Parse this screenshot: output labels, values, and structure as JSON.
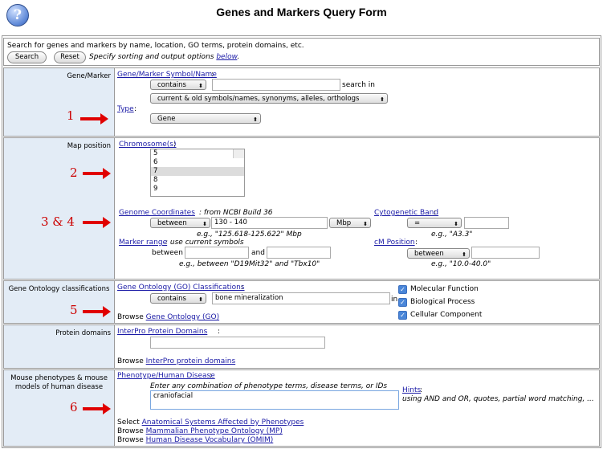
{
  "header": {
    "title": "Genes and Markers Query Form",
    "help_glyph": "?"
  },
  "intro": {
    "text": "Search for genes and markers by name, location, GO terms, protein domains, etc.",
    "search_label": "Search",
    "reset_label": "Reset",
    "options_text": "Specify sorting and output options",
    "options_link": "below"
  },
  "gene_marker": {
    "label": "Gene/Marker",
    "symbol_link": "Gene/Marker Symbol/Name",
    "operator": "contains",
    "value": "",
    "search_in_label": "search in",
    "search_in_value": "current & old symbols/names, synonyms, alleles, orthologs",
    "type_link": "Type",
    "type_value": "Gene",
    "annotation": "1"
  },
  "map_position": {
    "label": "Map position",
    "chromosome_link": "Chromosome(s)",
    "chromosome_options": [
      "5",
      "6",
      "7",
      "8",
      "9"
    ],
    "chromosome_selected": "7",
    "annotation_chr": "2",
    "genome_link": "Genome Coordinates",
    "genome_note": "from NCBI Build 36",
    "coord_operator": "between",
    "coord_value": "130 - 140",
    "coord_unit": "Mbp",
    "coord_example": "e.g., \"125.618-125.622\" Mbp",
    "annotation_coords": "3 & 4",
    "cyto_link": "Cytogenetic Band",
    "cyto_operator": "=",
    "cyto_value": "",
    "cyto_example": "e.g., \"A3.3\"",
    "marker_link": "Marker range",
    "marker_note": "use current symbols",
    "marker_between": "between",
    "marker_and": "and",
    "marker_example": "e.g., between \"D19Mit32\" and \"Tbx10\"",
    "cm_link": "cM Position",
    "cm_operator": "between",
    "cm_value": "",
    "cm_example": "e.g., \"10.0-40.0\""
  },
  "go": {
    "label": "Gene Ontology classifications",
    "link": "Gene Ontology (GO) Classifications",
    "operator": "contains",
    "value": "bone mineralization",
    "in_label": "in",
    "checkboxes": [
      "Molecular Function",
      "Biological Process",
      "Cellular Component"
    ],
    "browse_label": "Browse",
    "browse_link": "Gene Ontology (GO)",
    "annotation": "5"
  },
  "protein": {
    "label": "Protein domains",
    "link": "InterPro Protein Domains",
    "value": "",
    "browse_label": "Browse",
    "browse_link": "InterPro protein domains"
  },
  "phenotype": {
    "label": "Mouse phenotypes & mouse models of human disease",
    "link": "Phenotype/Human Disease",
    "instructions": "Enter any combination of phenotype terms, disease terms, or IDs",
    "value": "craniofacial",
    "hints_link": "Hints",
    "hints_text": "using AND and OR, quotes, partial word matching, ...",
    "select_label": "Select",
    "select_link": "Anatomical Systems Affected by Phenotypes",
    "browse_label": "Browse",
    "browse_mp": "Mammalian Phenotype Ontology (MP)",
    "browse_omim": "Human Disease Vocabulary (OMIM)",
    "annotation": "6"
  }
}
